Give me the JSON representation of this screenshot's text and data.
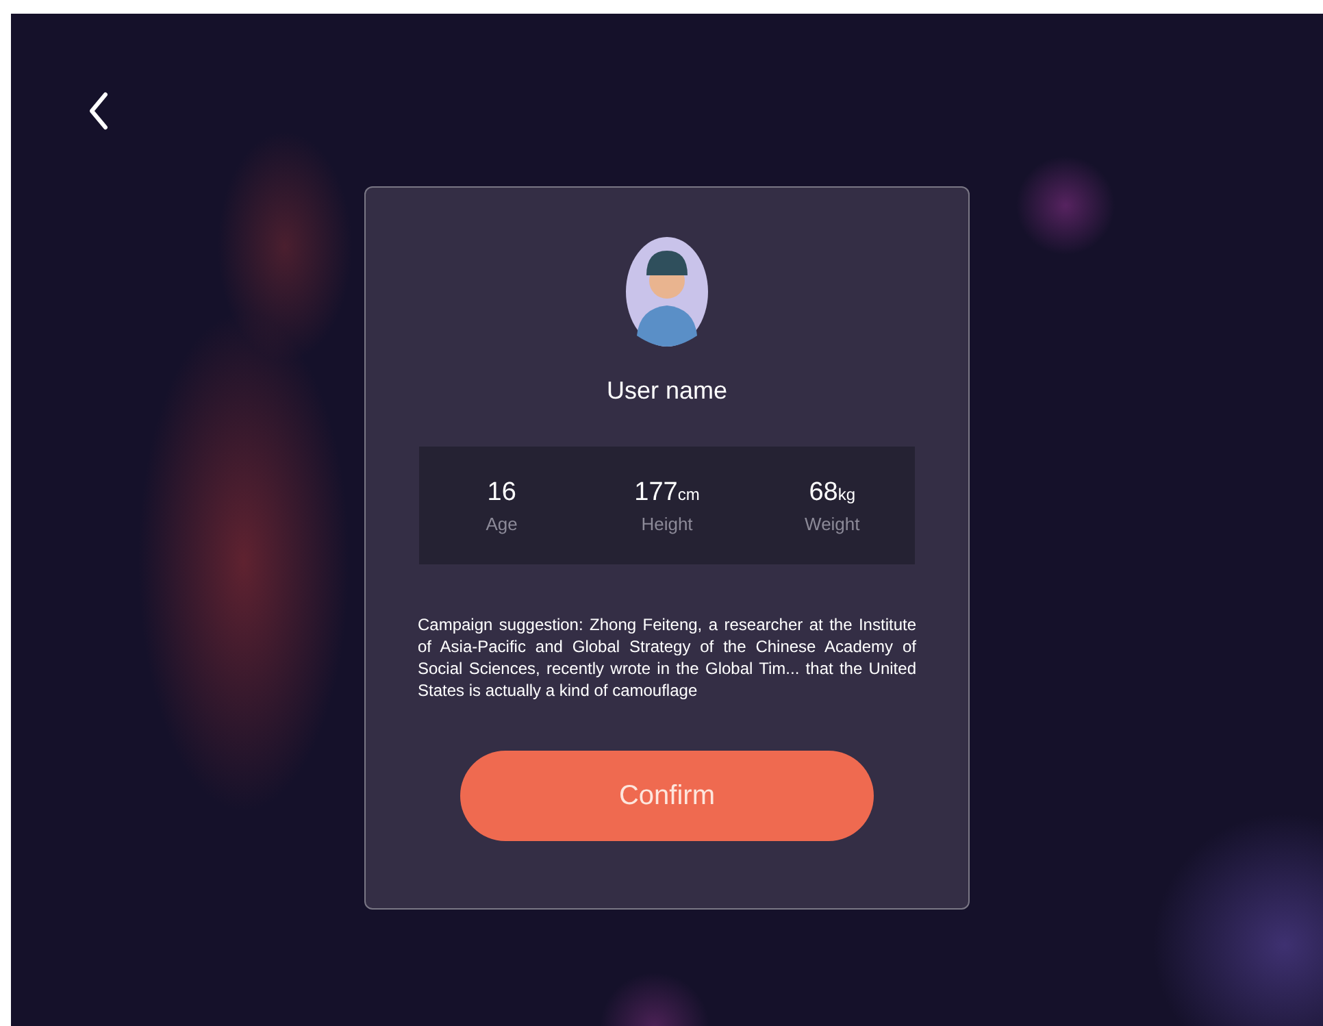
{
  "user": {
    "name": "User name"
  },
  "stats": [
    {
      "value": "16",
      "label": "Age"
    },
    {
      "value": "177",
      "unit": "cm",
      "label": "Height"
    },
    {
      "value": "68",
      "unit": "kg",
      "label": "Weight"
    }
  ],
  "suggestion": "Campaign suggestion: Zhong Feiteng, a researcher at the Institute of Asia-Pacific and Global Strategy of the Chinese Academy of Social Sciences, recently wrote in the Global Tim... that the United States is actually a kind of camouflage",
  "confirm_button": "Confirm"
}
